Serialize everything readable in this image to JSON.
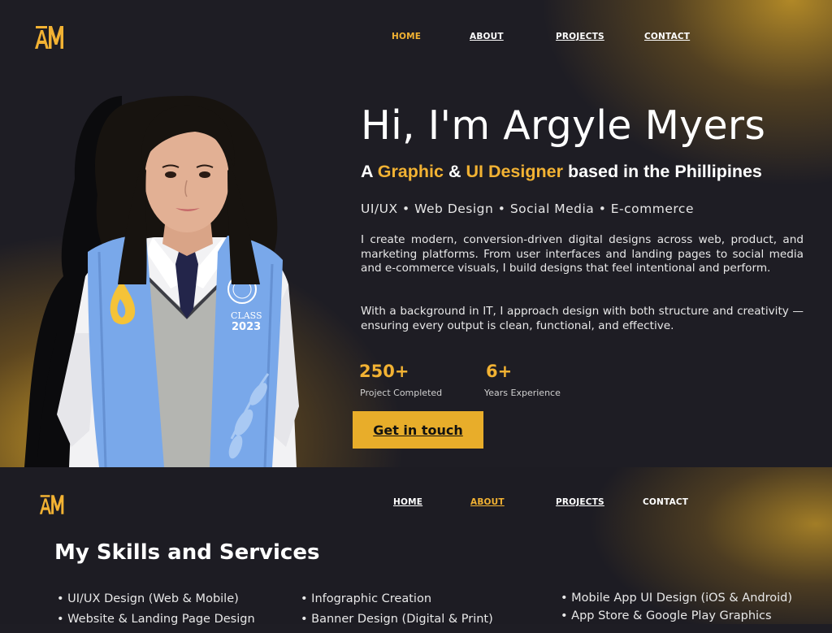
{
  "logo": {
    "text": "AM"
  },
  "nav": {
    "home": "HOME",
    "about": "ABOUT",
    "projects": "PROJECTS",
    "contact": "CONTACT"
  },
  "hero": {
    "title": "Hi, I'm Argyle Myers",
    "subtitle": {
      "a": "A",
      "graphic": "Graphic",
      "amp": "&",
      "ui": "UI Designer",
      "rest": "based in the Phillipines"
    },
    "tags": "UI/UX • Web Design • Social Media • E-commerce",
    "paragraph1": "I create modern, conversion-driven digital designs across web, product, and marketing platforms. From user interfaces and landing pages to social media and e-commerce visuals, I build designs that feel intentional and perform.",
    "paragraph2": "With a background in IT, I approach design with both structure and creativity — ensuring every output is clean, functional, and effective.",
    "stats": [
      {
        "value": "250+",
        "label": "Project Completed"
      },
      {
        "value": "6+",
        "label": "Years Experience"
      }
    ],
    "cta": "Get in touch",
    "stole_text": {
      "class": "CLASS",
      "year": "2023"
    }
  },
  "about": {
    "title": "My Skills and Services",
    "skills_col1": [
      "• UI/UX Design (Web & Mobile)",
      "• Website & Landing Page Design"
    ],
    "skills_col2": [
      "• Infographic Creation",
      "• Banner Design (Digital & Print)"
    ],
    "skills_col3": [
      "• Mobile App UI Design (iOS & Android)",
      "• App Store & Google Play Graphics"
    ]
  },
  "colors": {
    "background": "#1e1d24",
    "accent": "#f2b233",
    "cta": "#e8ad2a"
  }
}
